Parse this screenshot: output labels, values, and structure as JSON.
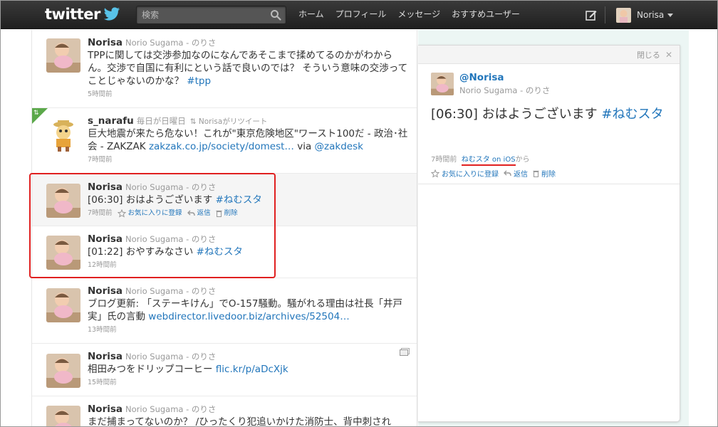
{
  "topbar": {
    "logo_text": "twitter",
    "search_placeholder": "検索",
    "nav": [
      "ホーム",
      "プロフィール",
      "メッセージ",
      "おすすめユーザー"
    ],
    "user_name": "Norisa"
  },
  "timeline": [
    {
      "user": "Norisa",
      "fullname": "Norio Sugama - のりさ",
      "text": "TPPに関しては交渉参加なのになんであそこまで揉めてるのかがわからん。交渉で自国に有利にという話で良いのでは？ そういう意味の交渉ってことじゃないのかな？",
      "link": "#tpp",
      "time": "5時間前"
    },
    {
      "user": "s_narafu",
      "fullname": "毎日が日曜日",
      "retweet": "Norisaがリツイート",
      "text": "巨大地震が来たら危ない！これが\"東京危険地区\"ワースト100だ - 政治･社会 - ZAKZAK",
      "link": "zakzak.co.jp/society/domest…",
      "via": "via",
      "via_link": "@zakdesk",
      "time": "7時間前"
    },
    {
      "user": "Norisa",
      "fullname": "Norio Sugama - のりさ",
      "text": "[06:30] おはようございます",
      "link": "#ねむスタ",
      "time": "7時間前",
      "actions": [
        "お気に入りに登録",
        "返信",
        "削除"
      ]
    },
    {
      "user": "Norisa",
      "fullname": "Norio Sugama - のりさ",
      "text": "[01:22] おやすみなさい",
      "link": "#ねむスタ",
      "time": "12時間前"
    },
    {
      "user": "Norisa",
      "fullname": "Norio Sugama - のりさ",
      "text": "ブログ更新: 「ステーキけん」でO-157騒動。騒がれる理由は社長「井戸実」氏の言動",
      "link": "webdirector.livedoor.biz/archives/52504…",
      "time": "13時間前"
    },
    {
      "user": "Norisa",
      "fullname": "Norio Sugama - のりさ",
      "text": "相田みつをドリップコーヒー",
      "link": "flic.kr/p/aDcXjk",
      "time": "15時間前"
    },
    {
      "user": "Norisa",
      "fullname": "Norio Sugama - のりさ",
      "text": "まだ捕まってないのか？ /ひったくり犯追いかけた消防士、背中刺され"
    }
  ],
  "detail": {
    "close_label": "閉じる",
    "screen_name": "@Norisa",
    "fullname": "Norio Sugama - のりさ",
    "text": "[06:30] おはようございます",
    "link": "#ねむスタ",
    "time": "7時間前",
    "source": "ねむスタ on iOS",
    "source_suffix": "から",
    "actions": [
      "お気に入りに登録",
      "返信",
      "削除"
    ]
  },
  "colors": {
    "link": "#2276bb",
    "highlight_border": "#e02020",
    "topbar": "#2b2b2b",
    "retweet_badge": "#5ba84a"
  },
  "icons": [
    "search-icon",
    "compose-icon",
    "twitter-bird-icon",
    "star-icon",
    "reply-icon",
    "trash-icon",
    "retweet-icon",
    "photo-icon",
    "close-icon"
  ]
}
